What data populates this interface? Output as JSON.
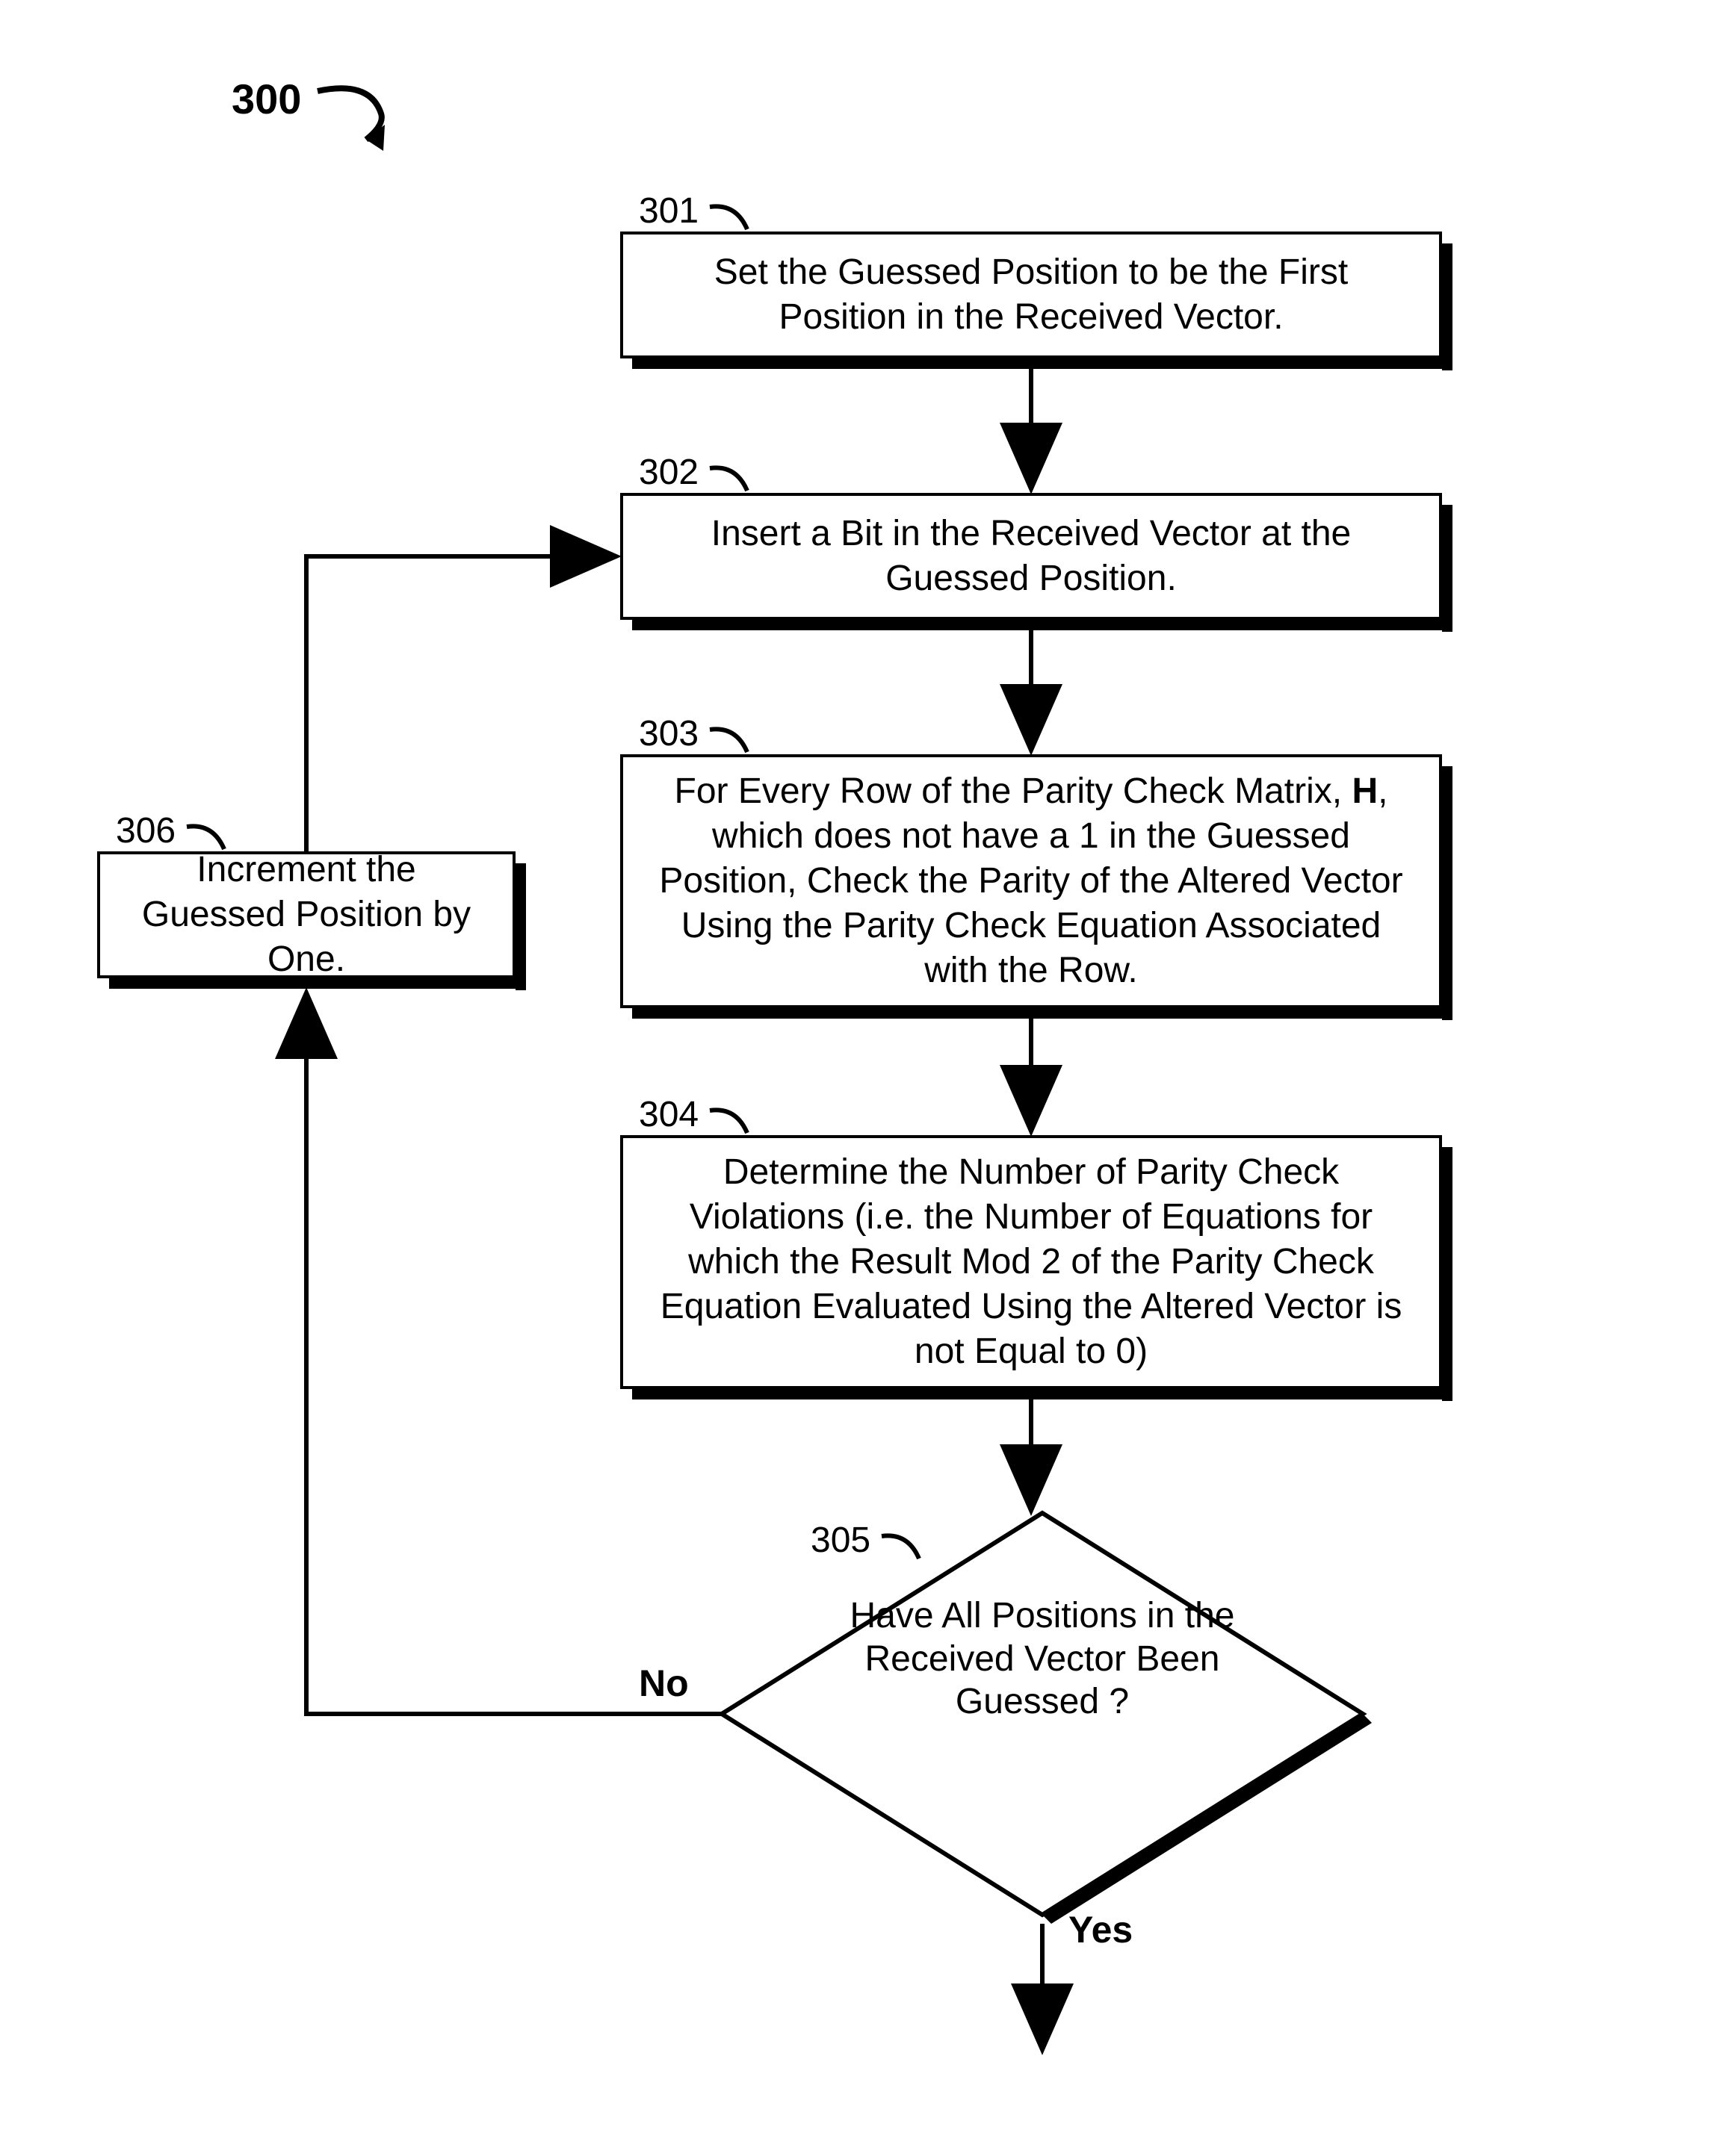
{
  "figure_number": "300",
  "labels": {
    "step301": "301",
    "step302": "302",
    "step303": "303",
    "step304": "304",
    "step305": "305",
    "step306": "306"
  },
  "boxes": {
    "b301": "Set the Guessed Position to be the First Position in the Received Vector.",
    "b302": "Insert a Bit in the Received Vector at the Guessed Position.",
    "b303_pre": "For Every Row of the Parity Check Matrix, ",
    "b303_bold": "H",
    "b303_post": ", which does not have a 1 in the  Guessed Position, Check the Parity of the Altered Vector Using the Parity Check Equation Associated with the Row.",
    "b304": "Determine the Number of Parity Check Violations (i.e. the Number of Equations for which the Result Mod 2 of the Parity Check Equation Evaluated Using the Altered Vector is not Equal to 0)",
    "b305": "Have All Positions in the Received Vector Been Guessed ?",
    "b306": "Increment the Guessed Position by One."
  },
  "edges": {
    "no": "No",
    "yes": "Yes"
  },
  "chart_data": {
    "type": "flowchart",
    "nodes": [
      {
        "id": "301",
        "kind": "process",
        "text": "Set the Guessed Position to be the First Position in the Received Vector."
      },
      {
        "id": "302",
        "kind": "process",
        "text": "Insert a Bit in the Received Vector at the Guessed Position."
      },
      {
        "id": "303",
        "kind": "process",
        "text": "For Every Row of the Parity Check Matrix, H, which does not have a 1 in the Guessed Position, Check the Parity of the Altered Vector Using the Parity Check Equation Associated with the Row."
      },
      {
        "id": "304",
        "kind": "process",
        "text": "Determine the Number of Parity Check Violations (i.e. the Number of Equations for which the Result Mod 2 of the Parity Check Equation Evaluated Using the Altered Vector is not Equal to 0)"
      },
      {
        "id": "305",
        "kind": "decision",
        "text": "Have All Positions in the Received Vector Been Guessed?"
      },
      {
        "id": "306",
        "kind": "process",
        "text": "Increment the Guessed Position by One."
      }
    ],
    "edges": [
      {
        "from": "301",
        "to": "302",
        "label": ""
      },
      {
        "from": "302",
        "to": "303",
        "label": ""
      },
      {
        "from": "303",
        "to": "304",
        "label": ""
      },
      {
        "from": "304",
        "to": "305",
        "label": ""
      },
      {
        "from": "305",
        "to": "306",
        "label": "No"
      },
      {
        "from": "306",
        "to": "302",
        "label": ""
      },
      {
        "from": "305",
        "to": "exit",
        "label": "Yes"
      }
    ],
    "figure_reference": "300"
  }
}
